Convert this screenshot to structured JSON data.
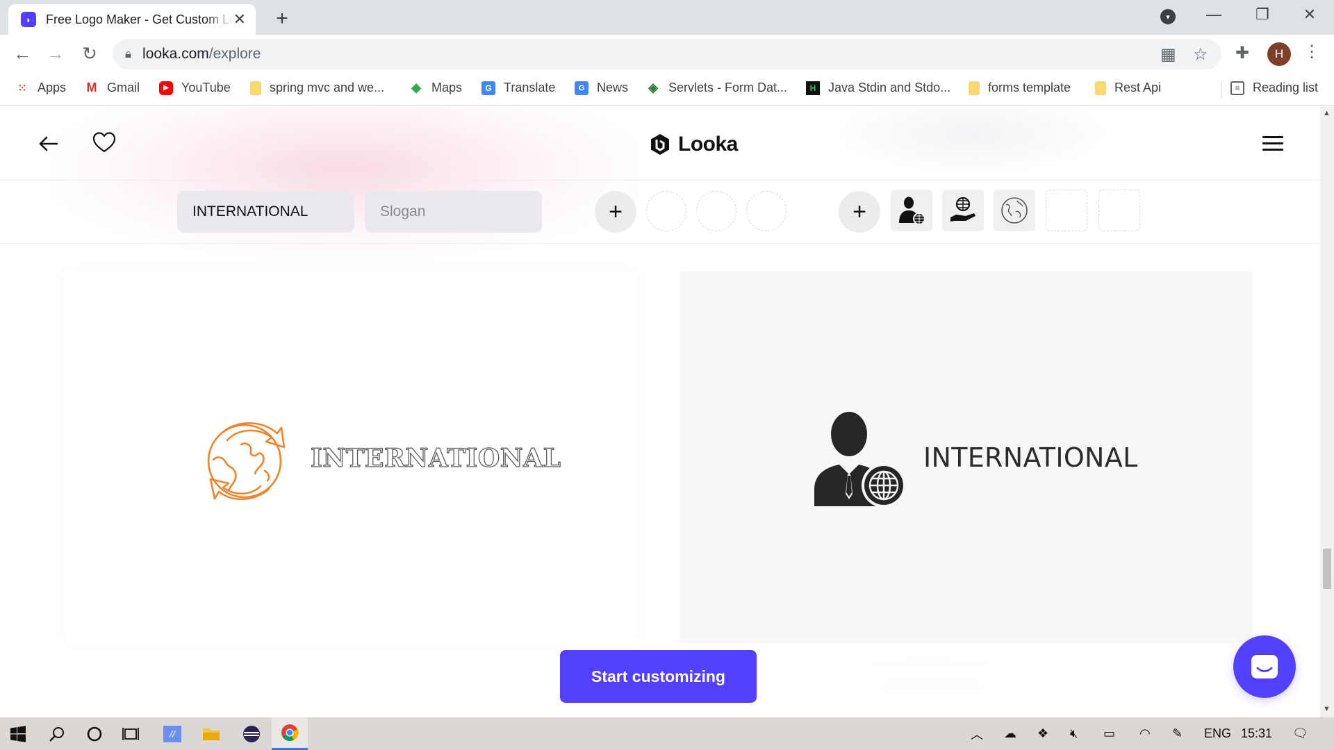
{
  "browser": {
    "tab": {
      "favicon": "looka-icon",
      "title": "Free Logo Maker - Get Custom Lo",
      "close": "✕"
    },
    "new_tab": "+",
    "window_controls": {
      "minimize": "—",
      "restore": "❐",
      "close": "✕"
    },
    "url": {
      "host": "looka.com",
      "path": "/explore"
    },
    "profile_initial": "H",
    "bookmarks": [
      {
        "label": "Apps",
        "icon": "apps-grid-icon"
      },
      {
        "label": "Gmail",
        "icon": "gmail-icon"
      },
      {
        "label": "YouTube",
        "icon": "youtube-icon"
      },
      {
        "label": "spring mvc and we...",
        "icon": "folder-icon"
      },
      {
        "label": "Maps",
        "icon": "maps-icon"
      },
      {
        "label": "Translate",
        "icon": "translate-icon"
      },
      {
        "label": "News",
        "icon": "news-icon"
      },
      {
        "label": "Servlets - Form Dat...",
        "icon": "servlets-icon"
      },
      {
        "label": "Java Stdin and Stdo...",
        "icon": "hackerrank-icon"
      },
      {
        "label": "forms template",
        "icon": "folder-icon"
      },
      {
        "label": "Rest Api",
        "icon": "folder-icon"
      }
    ],
    "reading_list": "Reading list"
  },
  "page": {
    "brand": "Looka",
    "editor": {
      "company_name": "INTERNATIONAL",
      "slogan_placeholder": "Slogan"
    },
    "logos": [
      {
        "text": "INTERNATIONAL",
        "icon": "globe-arrows-icon",
        "icon_color": "#f0832c"
      },
      {
        "text": "INTERNATIONAL",
        "icon": "businessman-globe-icon",
        "icon_color": "#262626"
      }
    ],
    "cta": "Start customizing",
    "accent": "#5340ff"
  },
  "taskbar": {
    "language": "ENG",
    "time": "15:31"
  }
}
